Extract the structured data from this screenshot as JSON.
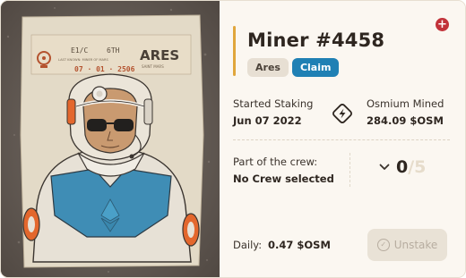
{
  "miner": {
    "title": "Miner #4458",
    "tags": {
      "location": "Ares",
      "claim": "Claim"
    }
  },
  "staking": {
    "started_label": "Started Staking",
    "started_value": "Jun 07 2022",
    "mined_label": "Osmium Mined",
    "mined_value": "284.09 $OSM"
  },
  "crew": {
    "label": "Part of the crew:",
    "value": "No Crew selected",
    "current": "0",
    "max": "/5"
  },
  "daily": {
    "label": "Daily:",
    "value": "0.47 $OSM"
  },
  "actions": {
    "unstake_label": "Unstake"
  },
  "poster": {
    "header_code_left": "E1/C",
    "header_code_right": "6TH",
    "header_subline": "LAST KNOWN: MINER OF MARS",
    "date": "07 · 01 · 2506",
    "place": "ARES",
    "place_sub": "SAINT MARS"
  },
  "colors": {
    "accent": "#e0a63c",
    "claim": "#1f80b4",
    "add": "#c2323a",
    "text": "#2e2620",
    "muted": "#e6dccb"
  },
  "icons": [
    "add-icon",
    "staking-icon",
    "chevron-down-icon",
    "unstake-icon"
  ]
}
